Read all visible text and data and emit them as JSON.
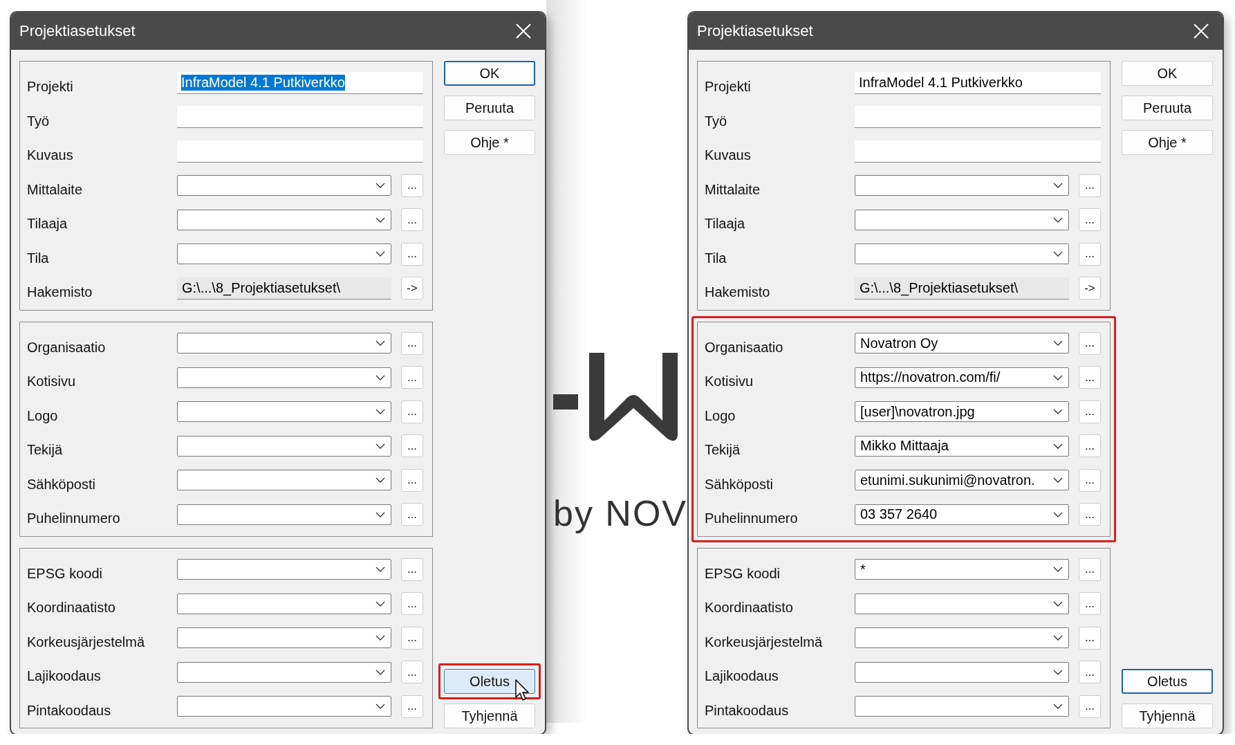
{
  "dialogs": [
    {
      "title": "Projektiasetukset",
      "groups": [
        {
          "highlighted": false,
          "rows": [
            {
              "kind": "text",
              "label": "Projekti",
              "value": "InfraModel 4.1 Putkiverkko",
              "value_selected": true
            },
            {
              "kind": "text",
              "label": "Työ"
            },
            {
              "kind": "text",
              "label": "Kuvaus"
            },
            {
              "kind": "combo",
              "label": "Mittalaite",
              "button": "..."
            },
            {
              "kind": "combo",
              "label": "Tilaaja",
              "button": "..."
            },
            {
              "kind": "combo",
              "label": "Tila",
              "button": "..."
            },
            {
              "kind": "path",
              "label": "Hakemisto",
              "value": "G:\\...\\8_Projektiasetukset\\",
              "button": "->"
            }
          ]
        },
        {
          "highlighted": false,
          "rows": [
            {
              "kind": "combo",
              "label": "Organisaatio",
              "button": "..."
            },
            {
              "kind": "combo",
              "label": "Kotisivu",
              "button": "..."
            },
            {
              "kind": "combo",
              "label": "Logo",
              "button": "..."
            },
            {
              "kind": "combo",
              "label": "Tekijä",
              "button": "..."
            },
            {
              "kind": "combo",
              "label": "Sähköposti",
              "button": "..."
            },
            {
              "kind": "combo",
              "label": "Puhelinnumero",
              "button": "..."
            }
          ]
        },
        {
          "highlighted": false,
          "rows": [
            {
              "kind": "combo",
              "label": "EPSG koodi",
              "button": "..."
            },
            {
              "kind": "combo",
              "label": "Koordinaatisto",
              "button": "..."
            },
            {
              "kind": "combo",
              "label": "Korkeusjärjestelmä",
              "button": "..."
            },
            {
              "kind": "combo",
              "label": "Lajikoodaus",
              "button": "..."
            },
            {
              "kind": "combo",
              "label": "Pintakoodaus",
              "button": "..."
            }
          ]
        }
      ],
      "buttons": [
        {
          "label": "OK",
          "focused": true,
          "hovered": false,
          "highlighted": false
        },
        {
          "label": "Peruuta",
          "focused": false,
          "hovered": false,
          "highlighted": false
        },
        {
          "label": "Ohje *",
          "focused": false,
          "hovered": false,
          "highlighted": false
        }
      ],
      "footer_buttons": [
        {
          "label": "Oletus",
          "focused": false,
          "hovered": true,
          "highlighted": true
        },
        {
          "label": "Tyhjennä",
          "focused": false,
          "hovered": false,
          "highlighted": false
        }
      ]
    },
    {
      "title": "Projektiasetukset",
      "groups": [
        {
          "highlighted": false,
          "rows": [
            {
              "kind": "text",
              "label": "Projekti",
              "value": "InfraModel 4.1 Putkiverkko",
              "value_selected": false
            },
            {
              "kind": "text",
              "label": "Työ"
            },
            {
              "kind": "text",
              "label": "Kuvaus"
            },
            {
              "kind": "combo",
              "label": "Mittalaite",
              "button": "..."
            },
            {
              "kind": "combo",
              "label": "Tilaaja",
              "button": "..."
            },
            {
              "kind": "combo",
              "label": "Tila",
              "button": "..."
            },
            {
              "kind": "path",
              "label": "Hakemisto",
              "value": "G:\\...\\8_Projektiasetukset\\",
              "button": "->"
            }
          ]
        },
        {
          "highlighted": true,
          "rows": [
            {
              "kind": "combo",
              "label": "Organisaatio",
              "value": "Novatron Oy",
              "button": "..."
            },
            {
              "kind": "combo",
              "label": "Kotisivu",
              "value": "https://novatron.com/fi/",
              "button": "..."
            },
            {
              "kind": "combo",
              "label": "Logo",
              "value": "[user]\\novatron.jpg",
              "button": "..."
            },
            {
              "kind": "combo",
              "label": "Tekijä",
              "value": "Mikko Mittaaja",
              "button": "..."
            },
            {
              "kind": "combo",
              "label": "Sähköposti",
              "value": "etunimi.sukunimi@novatron.",
              "button": "..."
            },
            {
              "kind": "combo",
              "label": "Puhelinnumero",
              "value": "03 357 2640",
              "button": "..."
            }
          ]
        },
        {
          "highlighted": false,
          "rows": [
            {
              "kind": "combo",
              "label": "EPSG koodi",
              "value": "*",
              "button": "..."
            },
            {
              "kind": "combo",
              "label": "Koordinaatisto",
              "button": "..."
            },
            {
              "kind": "combo",
              "label": "Korkeusjärjestelmä",
              "button": "..."
            },
            {
              "kind": "combo",
              "label": "Lajikoodaus",
              "button": "..."
            },
            {
              "kind": "combo",
              "label": "Pintakoodaus",
              "button": "..."
            }
          ]
        }
      ],
      "buttons": [
        {
          "label": "OK",
          "focused": false,
          "hovered": false,
          "highlighted": false
        },
        {
          "label": "Peruuta",
          "focused": false,
          "hovered": false,
          "highlighted": false
        },
        {
          "label": "Ohje *",
          "focused": false,
          "hovered": false,
          "highlighted": false
        }
      ],
      "footer_buttons": [
        {
          "label": "Oletus",
          "focused": true,
          "hovered": false,
          "highlighted": false
        },
        {
          "label": "Tyhjennä",
          "focused": false,
          "hovered": false,
          "highlighted": false
        }
      ]
    }
  ],
  "background_logo": {
    "tagline": "by NOV"
  }
}
